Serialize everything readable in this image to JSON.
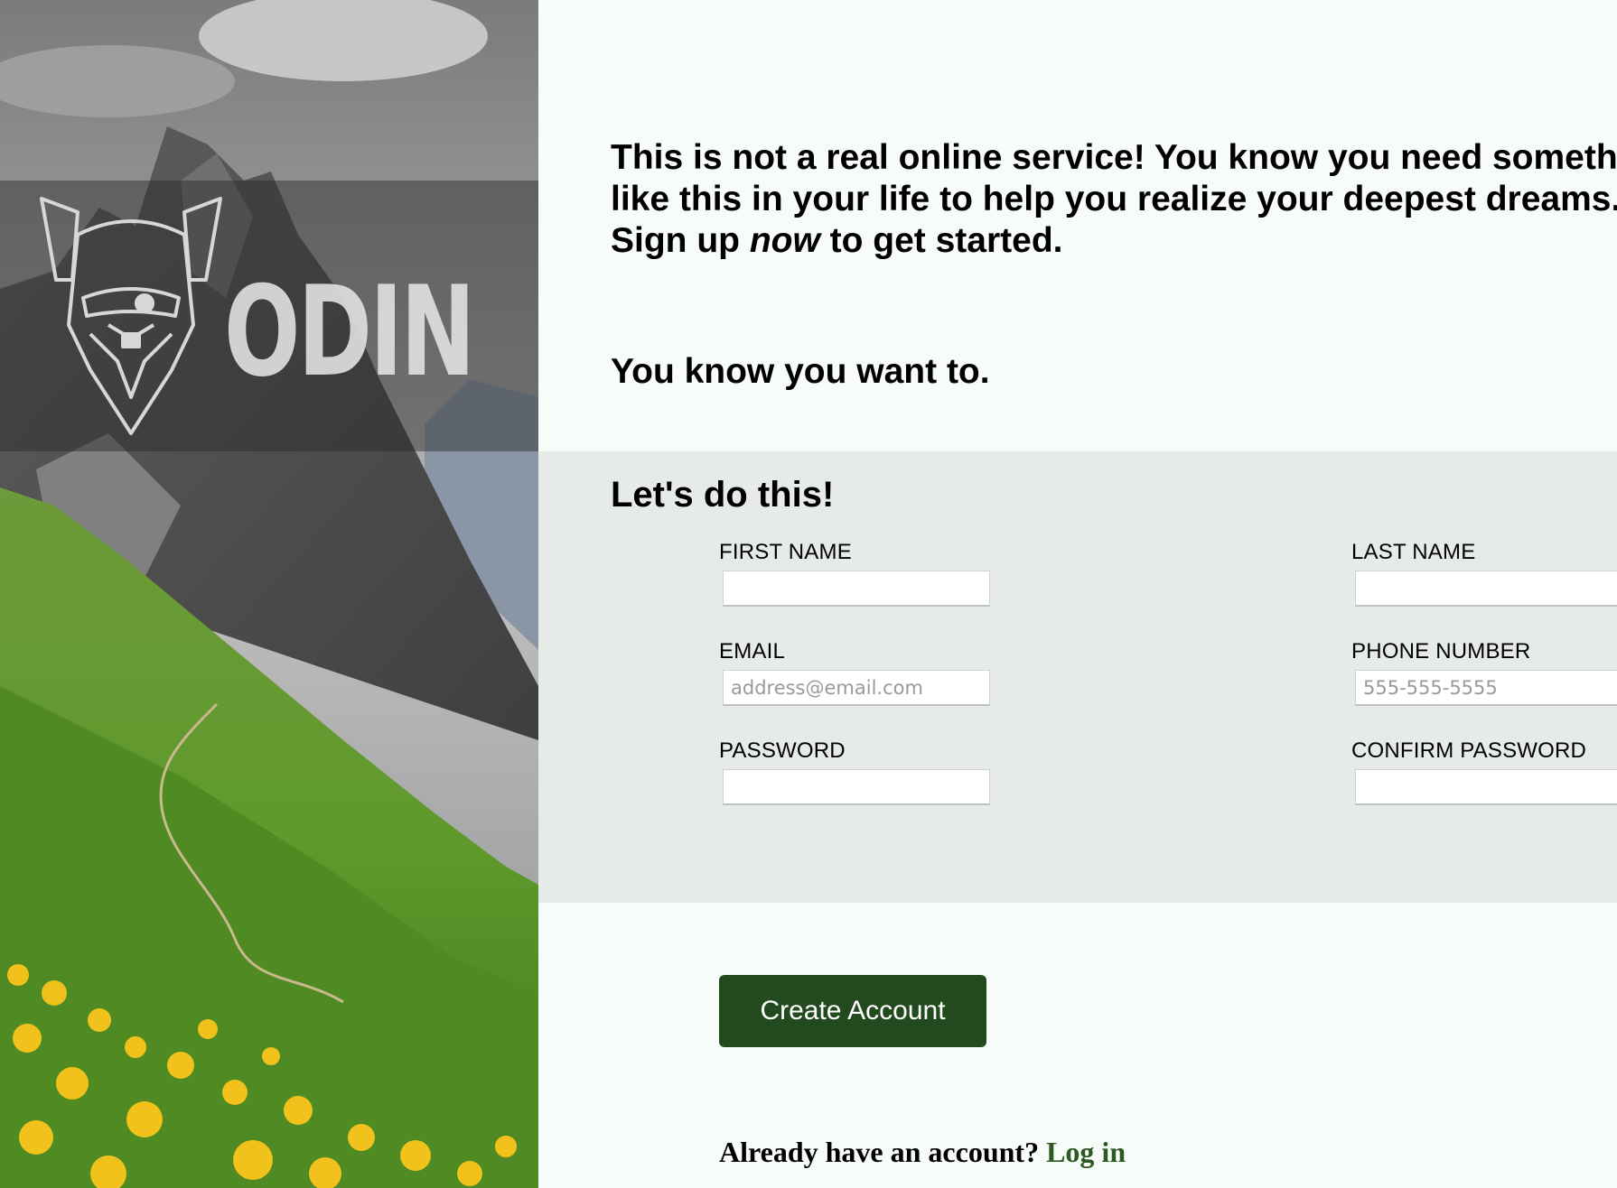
{
  "brand": {
    "logo_text": "ODIN"
  },
  "intro": {
    "line1": "This is not a real online service! You know you need something",
    "line2": "like this in your life to help you realize your deepest dreams.",
    "line3_pre": "Sign up ",
    "line3_em": "now",
    "line3_post": " to get started.",
    "line4": "You know you want to."
  },
  "form": {
    "title": "Let's do this!",
    "fields": {
      "first_name": {
        "label": "FIRST NAME",
        "placeholder": "",
        "value": ""
      },
      "last_name": {
        "label": "LAST NAME",
        "placeholder": "",
        "value": ""
      },
      "email": {
        "label": "EMAIL",
        "placeholder": "address@email.com",
        "value": ""
      },
      "phone": {
        "label": "PHONE NUMBER",
        "placeholder": "555-555-5555",
        "value": ""
      },
      "password": {
        "label": "PASSWORD",
        "placeholder": "",
        "value": ""
      },
      "confirm_password": {
        "label": "CONFIRM PASSWORD",
        "placeholder": "",
        "value": ""
      }
    },
    "submit_label": "Create Account"
  },
  "login": {
    "prompt": "Already have an account?",
    "link_label": "Log in"
  },
  "colors": {
    "button_bg": "#234a1e",
    "link": "#2d5a22",
    "form_bg": "#e7ebe8",
    "page_bg": "#f8fcf8"
  }
}
